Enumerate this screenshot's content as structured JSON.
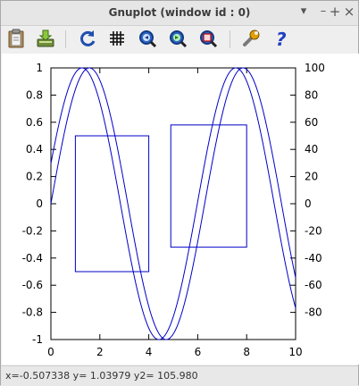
{
  "window": {
    "title": "Gnuplot (window id : 0)",
    "controls": {
      "menu": "▾",
      "minimize": "–",
      "maximize": "+",
      "close": "×"
    }
  },
  "toolbar": {
    "items": [
      {
        "icon": "clipboard-icon"
      },
      {
        "icon": "export-icon"
      },
      {
        "icon": "replot-icon"
      },
      {
        "icon": "grid-icon"
      },
      {
        "icon": "zoom-previous-icon"
      },
      {
        "icon": "zoom-next-icon"
      },
      {
        "icon": "autoscale-icon"
      },
      {
        "icon": "settings-icon"
      },
      {
        "icon": "help-icon"
      }
    ]
  },
  "status": {
    "text": "x=-0.507338 y= 1.03979 y2= 105.980"
  },
  "colors": {
    "curve": "#0000c8",
    "rect": "#0000c8",
    "help": "#1f3fbf"
  },
  "chart_data": {
    "type": "line",
    "title": "",
    "xlabel": "",
    "ylabel": "",
    "y2label": "",
    "xlim": [
      0,
      10
    ],
    "ylim": [
      -1,
      1
    ],
    "y2lim": [
      -100,
      100
    ],
    "xticks": [
      0,
      2,
      4,
      6,
      8,
      10
    ],
    "yticks": [
      -1,
      -0.8,
      -0.6,
      -0.4,
      -0.2,
      0,
      0.2,
      0.4,
      0.6,
      0.8,
      1
    ],
    "y2ticks": [
      -80,
      -60,
      -40,
      -20,
      0,
      20,
      40,
      60,
      80,
      100
    ],
    "y2tick_labels": [
      "-80",
      "-60",
      "-40",
      "-20",
      "0",
      "20",
      "40",
      "60",
      "80",
      "100"
    ],
    "series": [
      {
        "function": "sin(x)",
        "samples": 101,
        "x_start": 0,
        "x_end": 10
      },
      {
        "function": "sin(x+0.3)",
        "samples": 101,
        "x_start": 0,
        "x_end": 10
      }
    ],
    "rectangles": [
      {
        "x0": 1.0,
        "x1": 4.0,
        "y0": -0.5,
        "y1": 0.5
      },
      {
        "x0": 4.9,
        "x1": 8.0,
        "y0": -0.32,
        "y1": 0.58
      }
    ],
    "grid": false,
    "legend": "none"
  }
}
